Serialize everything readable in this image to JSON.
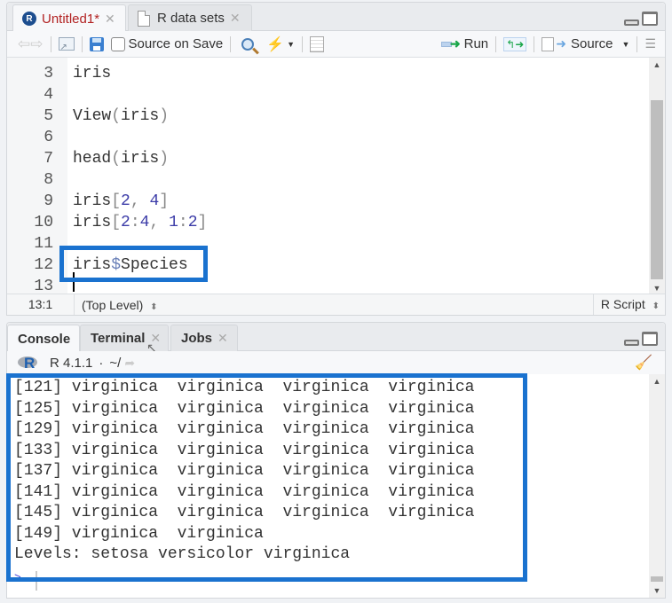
{
  "editor": {
    "tabs": [
      {
        "label": "Untitled1*",
        "icon": "r-file-icon",
        "active": true,
        "modified": true
      },
      {
        "label": "R data sets",
        "icon": "document-icon",
        "active": false
      }
    ],
    "toolbar": {
      "source_on_save_label": "Source on Save",
      "source_on_save_checked": false,
      "run_label": "Run",
      "source_label": "Source"
    },
    "lines": [
      {
        "number": "3",
        "tokens": [
          {
            "t": "iris",
            "c": "id"
          }
        ]
      },
      {
        "number": "4",
        "tokens": []
      },
      {
        "number": "5",
        "tokens": [
          {
            "t": "View",
            "c": "id"
          },
          {
            "t": "(",
            "c": "op"
          },
          {
            "t": "iris",
            "c": "id"
          },
          {
            "t": ")",
            "c": "op"
          }
        ]
      },
      {
        "number": "6",
        "tokens": []
      },
      {
        "number": "7",
        "tokens": [
          {
            "t": "head",
            "c": "id"
          },
          {
            "t": "(",
            "c": "op"
          },
          {
            "t": "iris",
            "c": "id"
          },
          {
            "t": ")",
            "c": "op"
          }
        ]
      },
      {
        "number": "8",
        "tokens": []
      },
      {
        "number": "9",
        "tokens": [
          {
            "t": "iris",
            "c": "id"
          },
          {
            "t": "[",
            "c": "op"
          },
          {
            "t": "2",
            "c": "num"
          },
          {
            "t": ", ",
            "c": "op"
          },
          {
            "t": "4",
            "c": "num"
          },
          {
            "t": "]",
            "c": "op"
          }
        ]
      },
      {
        "number": "10",
        "tokens": [
          {
            "t": "iris",
            "c": "id"
          },
          {
            "t": "[",
            "c": "op"
          },
          {
            "t": "2",
            "c": "num"
          },
          {
            "t": ":",
            "c": "op"
          },
          {
            "t": "4",
            "c": "num"
          },
          {
            "t": ", ",
            "c": "op"
          },
          {
            "t": "1",
            "c": "num"
          },
          {
            "t": ":",
            "c": "op"
          },
          {
            "t": "2",
            "c": "num"
          },
          {
            "t": "]",
            "c": "op"
          }
        ]
      },
      {
        "number": "11",
        "tokens": []
      },
      {
        "number": "12",
        "tokens": [
          {
            "t": "iris",
            "c": "id"
          },
          {
            "t": "$",
            "c": "dollar"
          },
          {
            "t": "Species",
            "c": "id"
          }
        ]
      },
      {
        "number": "13",
        "tokens": []
      }
    ],
    "status": {
      "cursor_position": "13:1",
      "scope": "(Top Level)",
      "file_type": "R Script"
    }
  },
  "console": {
    "tabs": [
      {
        "label": "Console",
        "active": true,
        "closable": false
      },
      {
        "label": "Terminal",
        "active": false,
        "closable": true
      },
      {
        "label": "Jobs",
        "active": false,
        "closable": true
      }
    ],
    "r_version": "R 4.1.1",
    "separator": "·",
    "working_dir": "~/",
    "output_lines": [
      "[121] virginica  virginica  virginica  virginica",
      "[125] virginica  virginica  virginica  virginica",
      "[129] virginica  virginica  virginica  virginica",
      "[133] virginica  virginica  virginica  virginica",
      "[137] virginica  virginica  virginica  virginica",
      "[141] virginica  virginica  virginica  virginica",
      "[145] virginica  virginica  virginica  virginica",
      "[149] virginica  virginica",
      "Levels: setosa versicolor virginica"
    ],
    "prompt": ">"
  },
  "colors": {
    "highlight_box": "#1a72cf",
    "modified_tab": "#b22222",
    "number_token": "#3c3ca8",
    "run_arrow": "#1aa64a"
  }
}
